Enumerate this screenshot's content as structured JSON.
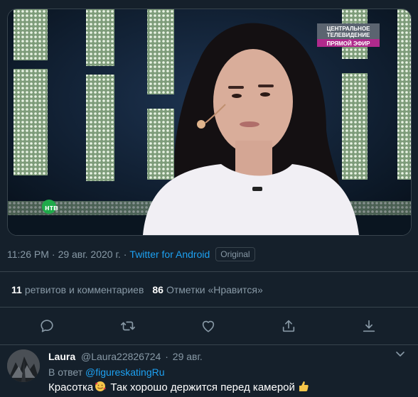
{
  "media": {
    "channel_badge_line1": "ЦЕНТРАЛЬНОЕ",
    "channel_badge_line2": "ТЕЛЕВИДЕНИЕ",
    "live_label": "ПРЯМОЙ ЭФИР",
    "channel_logo": "нтв"
  },
  "tweet": {
    "time": "11:26 PM",
    "separator": "·",
    "date": "29 авг. 2020 г.",
    "separator2": "·",
    "source": "Twitter for Android",
    "badge": "Original"
  },
  "stats": {
    "retweets_count": "11",
    "retweets_label": "ретвитов и комментариев",
    "likes_count": "86",
    "likes_label": "Отметки «Нравится»"
  },
  "actions": {
    "icons": [
      "reply-icon",
      "retweet-icon",
      "like-icon",
      "share-icon",
      "download-icon"
    ]
  },
  "reply": {
    "name": "Laura",
    "handle": "@Laura22826724",
    "separator": "·",
    "date": "29 авг.",
    "in_reply_prefix": "В ответ",
    "mention": "@figureskatingRu",
    "text_part1": "Красотка",
    "text_part2": "Так хорошо держится перед камерой"
  },
  "colors": {
    "background": "#15202b",
    "accent": "#1da1f2",
    "muted": "#8899a6",
    "border": "#38444d",
    "live_badge": "#b02a8c"
  }
}
